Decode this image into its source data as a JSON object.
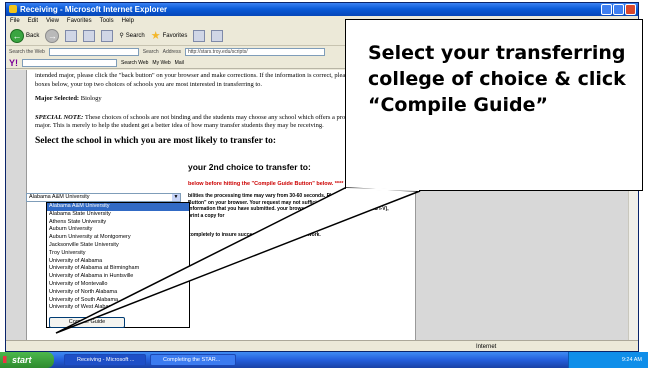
{
  "window": {
    "title": "Receiving - Microsoft Internet Explorer",
    "menu": [
      "File",
      "Edit",
      "View",
      "Favorites",
      "Tools",
      "Help"
    ],
    "toolbar": {
      "back_label": "Back",
      "search_label": "Search",
      "favorites_label": "Favorites"
    },
    "address": {
      "search_web_label": "Search the Web",
      "search_button": "Search",
      "address_label": "Address",
      "url": "http://stars.troy.edu/scripts/"
    },
    "ytoolbar": {
      "search_web_label": "Search Web",
      "my_web_label": "My Web",
      "mail_label": "Mail"
    },
    "status": {
      "zone": "Internet"
    }
  },
  "page": {
    "intro": "intended major, please click the \"back button\" on your browser and make corrections. If the information is correct, please select, in the two boxes below, your top two choices of schools you are most interested in transferring to.",
    "intro_button": "back button",
    "major_label": "Major Selected:",
    "major_value": "Biology",
    "special_label": "SPECIAL NOTE:",
    "special_text": "These choices of schools are not binding and the students may choose any school which offers a program in their chosen major. This is merely to help the student get a better idea of how many transfer students they may be receiving.",
    "select_heading": "Select the school in which you are most likely to transfer to:",
    "select_value": "Alabama A&M University",
    "second_heading": "your 2nd choice to transfer to:",
    "red_note": "below before hitting the \"Compile Guide Button\" below. ****",
    "note_1": "bilities the processing time may vary from 30-60 seconds. Please on the \"STOP Button\" on your browser. Your request may not sufficient time to process the information that you have submitted. your browser (scroll and check for AREAS I-V), print a copy for",
    "note_2": "completely to insure successful transfer of coursework.",
    "dropdown": [
      "Alabama A&M University",
      "Alabama State University",
      "Athens State University",
      "Auburn University",
      "Auburn University at Montgomery",
      "Jacksonville State University",
      "Troy University",
      "University of Alabama",
      "University of Alabama at Birmingham",
      "University of Alabama in Huntsville",
      "University of Montevallo",
      "University of North Alabama",
      "University of South Alabama",
      "University of West Alabama"
    ],
    "compile_button": "Compile Guide"
  },
  "taskbar": {
    "start": "start",
    "tasks": [
      "Receiving - Microsoft ...",
      "Completing the STAR..."
    ],
    "clock": "9:24 AM"
  },
  "callout": {
    "text": "Select your transferring college of choice & click “Compile Guide”"
  }
}
